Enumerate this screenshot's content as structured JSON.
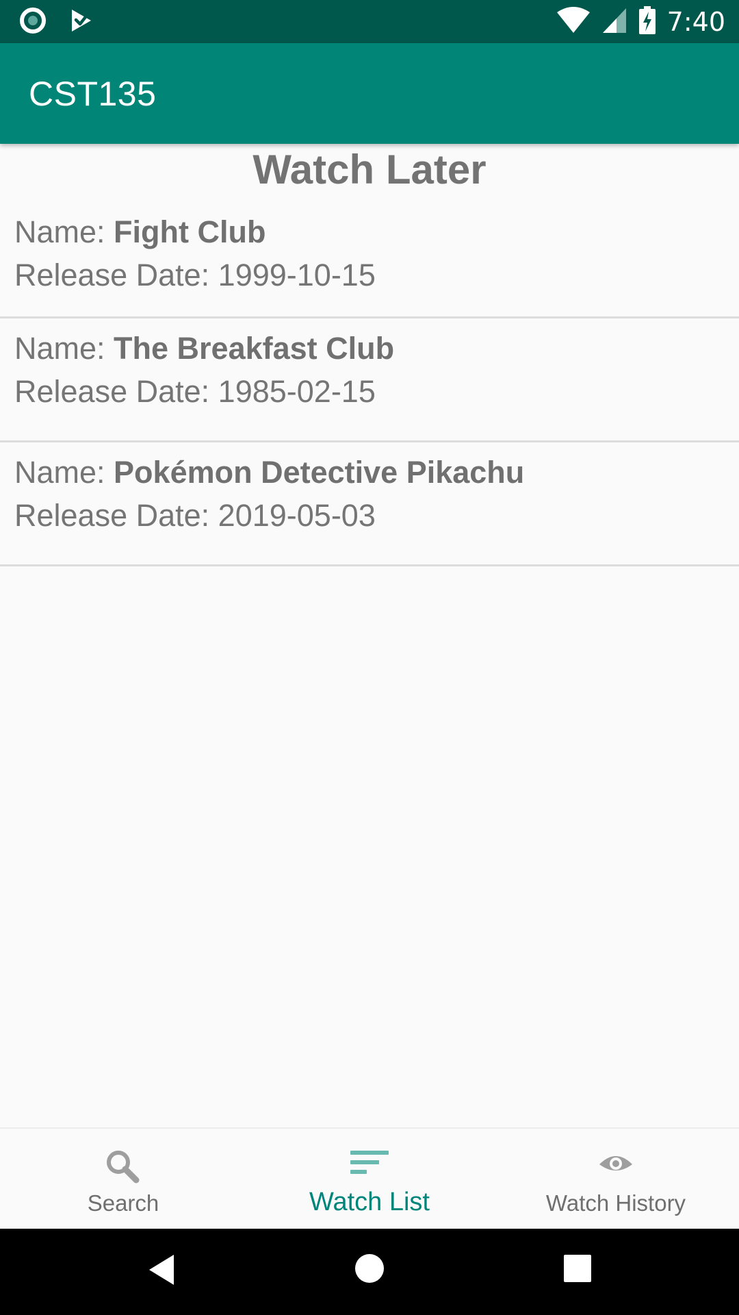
{
  "status_bar": {
    "time": "7:40",
    "icons": [
      "record-icon",
      "play-store-icon",
      "wifi-icon",
      "signal-icon",
      "battery-charging-icon"
    ]
  },
  "app_bar": {
    "title": "CST135"
  },
  "main": {
    "heading": "Watch Later",
    "name_prefix": "Name: ",
    "release_prefix": "Release Date: ",
    "movies": [
      {
        "name": "Fight Club",
        "release_date": "1999-10-15"
      },
      {
        "name": "The Breakfast Club",
        "release_date": "1985-02-15"
      },
      {
        "name": "Pokémon Detective Pikachu",
        "release_date": "2019-05-03"
      }
    ]
  },
  "bottom_nav": {
    "items": [
      {
        "label": "Search",
        "icon": "search-icon",
        "active": false
      },
      {
        "label": "Watch List",
        "icon": "list-icon",
        "active": true
      },
      {
        "label": "Watch History",
        "icon": "eye-icon",
        "active": false
      }
    ],
    "active_color": "#00857b",
    "inactive_color": "#6f6f6f"
  },
  "system_nav": {
    "icons": [
      "back-icon",
      "home-icon",
      "recents-icon"
    ]
  },
  "colors": {
    "status_bar": "#00574b",
    "app_bar": "#008577",
    "background": "#fafafa"
  }
}
